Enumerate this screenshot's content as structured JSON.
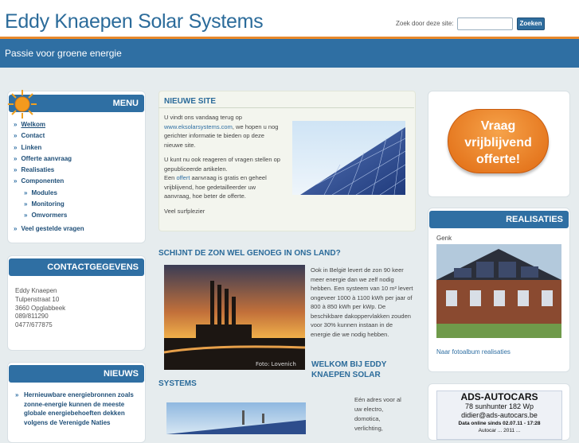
{
  "header": {
    "title": "Eddy Knaepen Solar Systems",
    "search_label": "Zoek door deze site:",
    "search_placeholder": "",
    "search_button": "Zoeken",
    "tagline": "Passie voor groene energie"
  },
  "menu": {
    "title": "MENU",
    "items": [
      {
        "label": "Welkom",
        "level": 0,
        "active": true
      },
      {
        "label": "Contact",
        "level": 0
      },
      {
        "label": "Linken",
        "level": 0
      },
      {
        "label": "Offerte aanvraag",
        "level": 0
      },
      {
        "label": "Realisaties",
        "level": 0
      },
      {
        "label": "Componenten",
        "level": 0
      },
      {
        "label": "Modules",
        "level": 1
      },
      {
        "label": "Monitoring",
        "level": 1
      },
      {
        "label": "Omvormers",
        "level": 1
      },
      {
        "label": "Veel gestelde vragen",
        "level": 0
      }
    ]
  },
  "contact": {
    "title": "CONTACTGEGEVENS",
    "lines": [
      "Eddy Knaepen",
      "Tulpenstraat 10",
      "3660 Opglabbeek",
      "089/811290",
      "0477/677875"
    ]
  },
  "news": {
    "title": "NIEUWS",
    "item": "Hernieuwbare energiebronnen zoals zonne-energie kunnen de meeste globale energiebehoeften dekken volgens de Verenigde Naties"
  },
  "nieuwe_site": {
    "title": "NIEUWE SITE",
    "p1_pre": "U vindt ons vandaag terug op",
    "p1_link": "www.eksolarsystems.com",
    "p1_post": ", we hopen u nog gerichter informatie te bieden op deze nieuwe site.",
    "p2_a": "U kunt nu ook reageren of vragen stellen op gepubliceerde artikelen.",
    "p2_b_pre": "Een",
    "p2_b_link": "offert",
    "p2_b_post": "aanvraag is gratis en geheel vrijblijvend, hoe gedetailleerder uw aanvraag, hoe beter de offerte.",
    "p3": "Veel surfplezier"
  },
  "zon": {
    "title": "SCHIJNT DE ZON WEL GENOEG IN ONS LAND?",
    "text": "Ook in België levert de zon 90 keer meer energie dan we zelf nodig hebben. Een systeem van 10 m² levert ongeveer 1000 à 1100 kWh per jaar of 800 à 850 kWh per kWp. De beschikbare dakoppervlakken zouden voor 30% kunnen instaan in de energie die we nodig hebben.",
    "photo_credit": "Foto: Lovenich"
  },
  "welkom": {
    "title_a": "WELKOM BIJ EDDY",
    "title_b": "KNAEPEN SOLAR",
    "title_c": "SYSTEMS",
    "lines": [
      "Eén adres voor al",
      "uw electro,",
      "domotica,",
      "verlichting,"
    ]
  },
  "offerte_button": {
    "lines": [
      "Vraag",
      "vrijblijvend",
      "offerte!"
    ]
  },
  "realisaties": {
    "title": "REALISATIES",
    "location": "Genk",
    "link": "Naar fotoalbum realisaties"
  },
  "ad": {
    "title": "ADS-AUTOCARS",
    "line1": "78 sunhunter 182 Wp",
    "line2": "didier@ads-autocars.be",
    "line3": "Data online sinds 02.07.11 - 17:28",
    "line4": "Autocar ... 2011 ..."
  }
}
